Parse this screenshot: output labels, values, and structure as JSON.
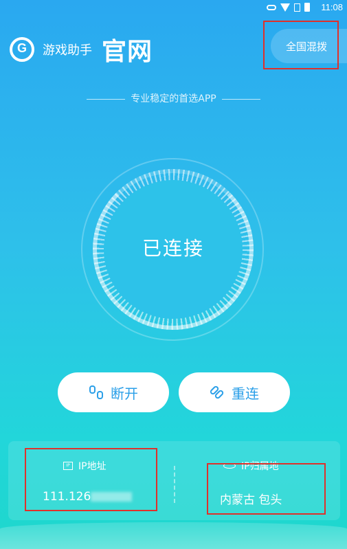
{
  "status_bar": {
    "time": "11:08",
    "icons": [
      "key-icon",
      "wifi-icon",
      "sim-icon",
      "battery-icon"
    ]
  },
  "header": {
    "app_name": "游戏助手",
    "official_label": "官网",
    "region_button": "全国混拨"
  },
  "tagline": "专业稳定的首选APP",
  "connection": {
    "status": "已连接"
  },
  "actions": {
    "disconnect": "断开",
    "reconnect": "重连"
  },
  "info": {
    "ip_label": "IP地址",
    "ip_value": "111.126",
    "location_label": "IP归属地",
    "location_value": "内蒙古 包头"
  },
  "colors": {
    "accent": "#2a9fe8",
    "highlight": "#e0302a"
  }
}
